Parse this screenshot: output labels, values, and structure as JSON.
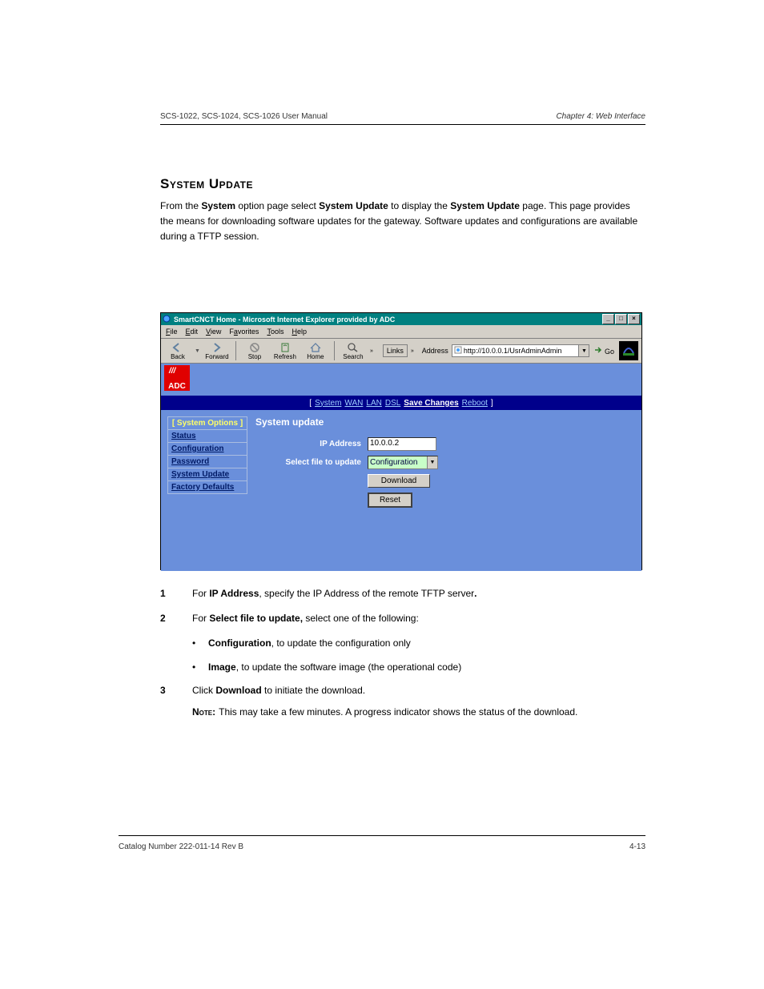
{
  "header": {
    "left": "SCS-1022, SCS-1024, SCS-1026 User Manual",
    "right": "Chapter 4: Web Interface"
  },
  "section": {
    "heading": "System Update",
    "para_before": "From the ",
    "para_b1": "System",
    "para_mid1": " option page select ",
    "para_b2": "System Update",
    "para_mid2": " to display the ",
    "para_b3": "System Update",
    "para_after": " page. This page provides the means for downloading software updates for the gateway. Software updates and configurations are available during a TFTP session."
  },
  "screenshot": {
    "title": "SmartCNCT Home - Microsoft Internet Explorer provided by ADC",
    "menu": {
      "file": "File",
      "edit": "Edit",
      "view": "View",
      "favorites": "Favorites",
      "tools": "Tools",
      "help": "Help"
    },
    "toolbar": {
      "back": "Back",
      "forward": "Forward",
      "stop": "Stop",
      "refresh": "Refresh",
      "home": "Home",
      "search": "Search",
      "links": "Links",
      "address_label": "Address",
      "address_value": "http://10.0.0.1/UsrAdminAdmin",
      "go": "Go"
    },
    "logo_text": "ADC",
    "topnav": {
      "system": "System",
      "wan": "WAN",
      "lan": "LAN",
      "dsl": "DSL",
      "save": "Save Changes",
      "reboot": "Reboot"
    },
    "sidebar": {
      "header": "[ System Options ]",
      "status": "Status",
      "configuration": "Configuration",
      "password": "Password",
      "system_update": "System Update",
      "factory_defaults": "Factory Defaults"
    },
    "form": {
      "title": "System update",
      "ip_label": "IP Address",
      "ip_value": "10.0.0.2",
      "file_label": "Select file to update",
      "file_value": "Configuration",
      "download": "Download",
      "reset": "Reset"
    },
    "win_btns": {
      "min": "_",
      "max": "□",
      "close": "×"
    }
  },
  "steps": {
    "s1": {
      "num": "1",
      "before": "For ",
      "b": "IP Address",
      "after": ", specify the IP Address of the remote TFTP server",
      "period": "."
    },
    "s2": {
      "num": "2",
      "before": "For ",
      "b": "Select file to update,",
      "after": " select one of the following:",
      "opt1_b": "Configuration",
      "opt1_rest": ", to update the configuration only",
      "opt2_b": "Image",
      "opt2_rest": ", to update the software image (the operational code)"
    },
    "s3": {
      "num": "3",
      "before": "Click ",
      "b": "Download",
      "after": " to initiate the download.",
      "note_label": "Note:",
      "note_text": "This may take a few minutes. A progress indicator shows the status of the download."
    }
  },
  "footer": {
    "left": "Catalog Number 222-011-14 Rev B",
    "center": "",
    "right": "4-13"
  }
}
